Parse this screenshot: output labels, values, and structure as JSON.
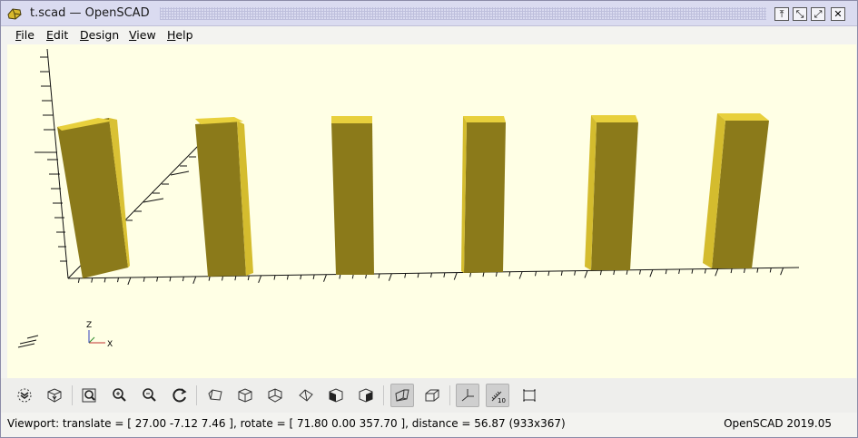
{
  "window": {
    "title": "t.scad — OpenSCAD"
  },
  "titlebar_buttons": {
    "pin": "⤒",
    "shade": "⤡",
    "maximize": "⤢",
    "close": "✕"
  },
  "menu": [
    {
      "label": "File",
      "accel": "F",
      "rest": "ile"
    },
    {
      "label": "Edit",
      "accel": "E",
      "rest": "dit"
    },
    {
      "label": "Design",
      "accel": "D",
      "rest": "esign"
    },
    {
      "label": "View",
      "accel": "V",
      "rest": "iew"
    },
    {
      "label": "Help",
      "accel": "H",
      "rest": "elp"
    }
  ],
  "viewport": {
    "background": "#ffffe5",
    "object_color": "#8b7a1a",
    "object_side_color": "#d4bc2e",
    "object_top_color": "#e8d03c",
    "axis_labels": {
      "z": "Z",
      "x": "X"
    }
  },
  "toolbar": {
    "tools": [
      {
        "name": "preview",
        "icon": "preview-icon"
      },
      {
        "name": "render",
        "icon": "render-icon"
      },
      {
        "name": "view-all",
        "icon": "view-all-icon"
      },
      {
        "name": "zoom-in",
        "icon": "zoom-in-icon"
      },
      {
        "name": "zoom-out",
        "icon": "zoom-out-icon"
      },
      {
        "name": "reset-view",
        "icon": "reset-view-icon"
      },
      {
        "name": "view-right",
        "icon": "cube-right-icon"
      },
      {
        "name": "view-top",
        "icon": "cube-top-icon"
      },
      {
        "name": "view-bottom",
        "icon": "cube-bottom-icon"
      },
      {
        "name": "view-left",
        "icon": "cube-left-icon"
      },
      {
        "name": "view-front",
        "icon": "cube-front-icon"
      },
      {
        "name": "view-back",
        "icon": "cube-back-icon"
      },
      {
        "name": "perspective",
        "icon": "perspective-icon",
        "active": true
      },
      {
        "name": "orthogonal",
        "icon": "orthogonal-icon"
      },
      {
        "name": "show-axes",
        "icon": "axes-icon",
        "active": true
      },
      {
        "name": "show-scale",
        "icon": "scale-markers-icon",
        "active": true
      },
      {
        "name": "show-edges",
        "icon": "edges-icon"
      }
    ]
  },
  "status": {
    "viewport_text": "Viewport: translate = [ 27.00 -7.12 7.46 ], rotate = [ 71.80 0.00 357.70 ], distance = 56.87 (933x367)",
    "version": "OpenSCAD 2019.05"
  }
}
